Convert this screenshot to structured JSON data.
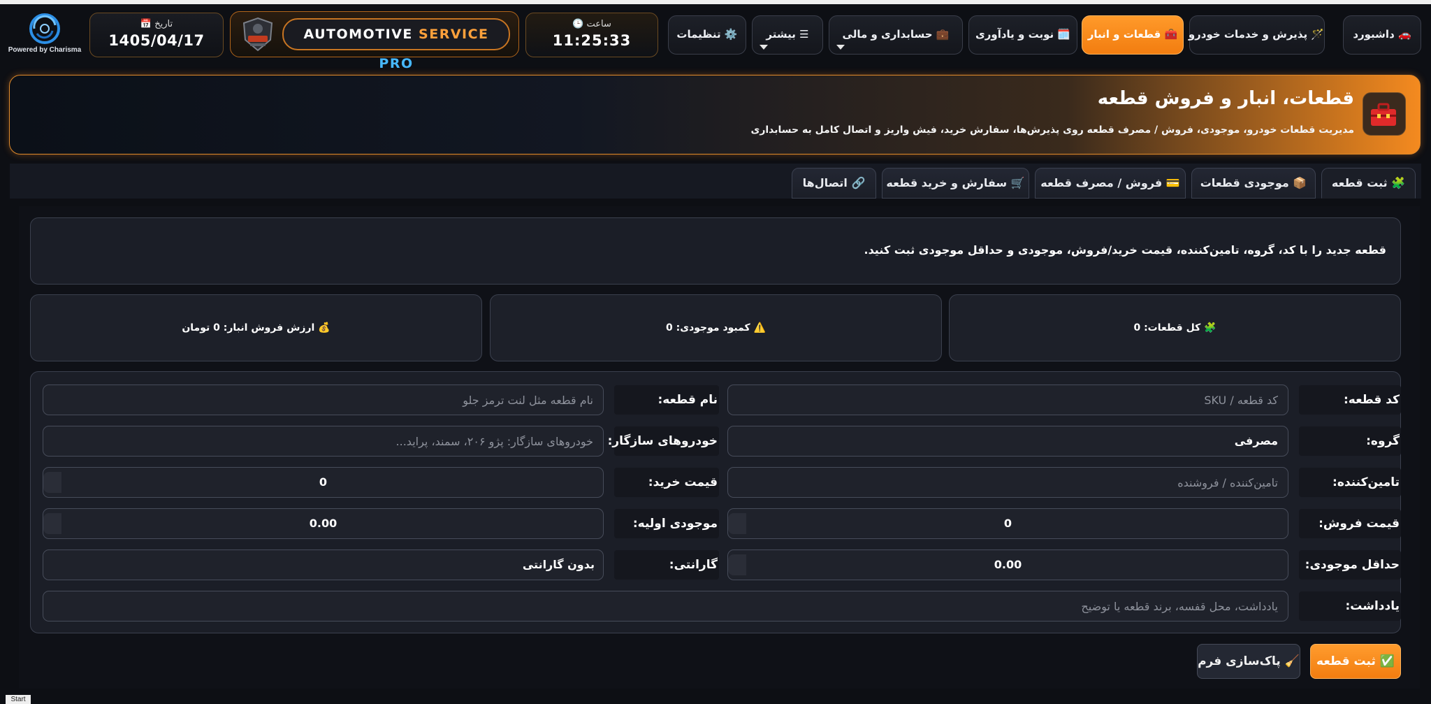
{
  "brand": {
    "powered_by": "Powered by Charisma"
  },
  "date_widget": {
    "label": "📅 تاریخ",
    "value": "1405/04/17"
  },
  "app_title": {
    "part1": "AUTOMOTIVE ",
    "part2": "SERVICE ",
    "part3": "PRO"
  },
  "clock_widget": {
    "label": "🕒 ساعت",
    "value": "11:25:33"
  },
  "nav": {
    "dashboard": "🚗 داشبورد",
    "reception": "🪄 پذیرش و خدمات خودرو",
    "parts": "🧰 قطعات و انبار",
    "appointments": "🗓️ نوبت و یادآوری",
    "accounting": "💼 حسابداری و مالی",
    "more": "☰ بیشتر",
    "settings": "⚙️ تنظیمات"
  },
  "header": {
    "title": "قطعات، انبار و فروش قطعه",
    "subtitle": "مدیریت قطعات خودرو، موجودی، فروش / مصرف قطعه روی پذیرش‌ها، سفارش خرید، فیش واریز و اتصال کامل به حسابداری"
  },
  "tabs": [
    {
      "label": "🧩 ثبت قطعه",
      "active": true
    },
    {
      "label": "📦 موجودی قطعات",
      "active": false
    },
    {
      "label": "💳 فروش / مصرف قطعه",
      "active": false
    },
    {
      "label": "🛒 سفارش و خرید قطعه",
      "active": false
    },
    {
      "label": "🔗 اتصال‌ها",
      "active": false
    }
  ],
  "info": {
    "text": "قطعه جدید را با کد، گروه، تامین‌کننده، قیمت خرید/فروش، موجودی و حداقل موجودی ثبت کنید."
  },
  "stats": {
    "total_parts": "🧩 کل قطعات: 0",
    "low_stock": "⚠️ کمبود موجودی: 0",
    "stock_value": "💰 ارزش فروش انبار: 0 تومان"
  },
  "form": {
    "code_label": "کد قطعه:",
    "code_placeholder": "کد قطعه / SKU",
    "name_label": "نام قطعه:",
    "name_placeholder": "نام قطعه مثل لنت ترمز جلو",
    "group_label": "گروه:",
    "group_value": "مصرفی",
    "vehicles_label": "خودروهای سازگار:",
    "vehicles_placeholder": "خودروهای سازگار: پژو ۲۰۶، سمند، پراید...",
    "supplier_label": "تامین‌کننده:",
    "supplier_placeholder": "تامین‌کننده / فروشنده",
    "buy_price_label": "قیمت خرید:",
    "buy_price_value": "0",
    "sell_price_label": "قیمت فروش:",
    "sell_price_value": "0",
    "initial_stock_label": "موجودی اولیه:",
    "initial_stock_value": "0.00",
    "min_stock_label": "حداقل موجودی:",
    "min_stock_value": "0.00",
    "warranty_label": "گارانتی:",
    "warranty_value": "بدون گارانتی",
    "notes_label": "یادداشت:",
    "notes_placeholder": "یادداشت، محل قفسه، برند قطعه یا توضیح"
  },
  "buttons": {
    "submit": "✅ ثبت قطعه",
    "clear": "🧹 پاک‌سازی فرم"
  },
  "taskbar": {
    "start": "Start"
  },
  "colors": {
    "accent": "#f58a1f",
    "bg": "#0d0f14",
    "card": "#1b1e27",
    "border": "#3b404e"
  }
}
